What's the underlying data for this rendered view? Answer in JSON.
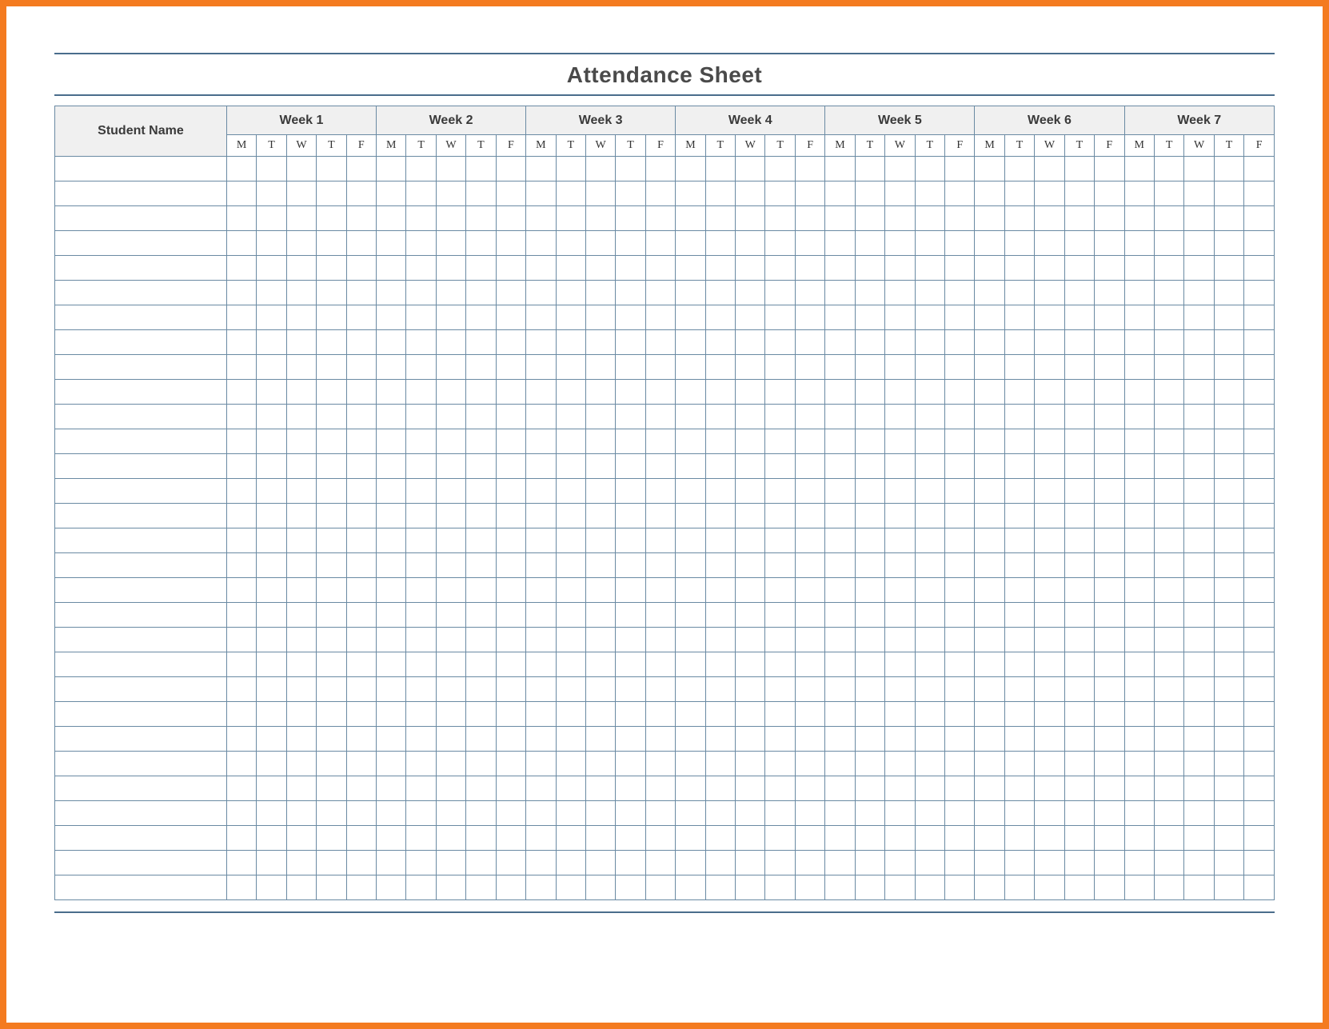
{
  "title": "Attendance Sheet",
  "header": {
    "name_col": "Student Name",
    "weeks": [
      "Week 1",
      "Week 2",
      "Week 3",
      "Week 4",
      "Week 5",
      "Week 6",
      "Week 7"
    ]
  },
  "days": [
    "M",
    "T",
    "W",
    "T",
    "F"
  ],
  "num_weeks": 7,
  "num_rows": 30
}
